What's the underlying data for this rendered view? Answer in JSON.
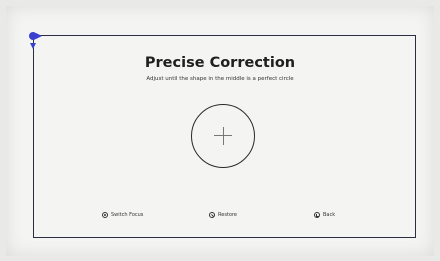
{
  "screen": {
    "title": "Precise Correction",
    "subtitle": "Adjust until the shape in the middle is a perfect circle"
  },
  "hints": [
    {
      "icon": "ok-button-icon",
      "label": "Switch Focus"
    },
    {
      "icon": "restore-icon",
      "label": "Restore"
    },
    {
      "icon": "back-icon",
      "label": "Back"
    }
  ],
  "colors": {
    "frame": "#2b2d42",
    "active_corner": "#3b3fd0",
    "background": "#f4f4f2"
  }
}
